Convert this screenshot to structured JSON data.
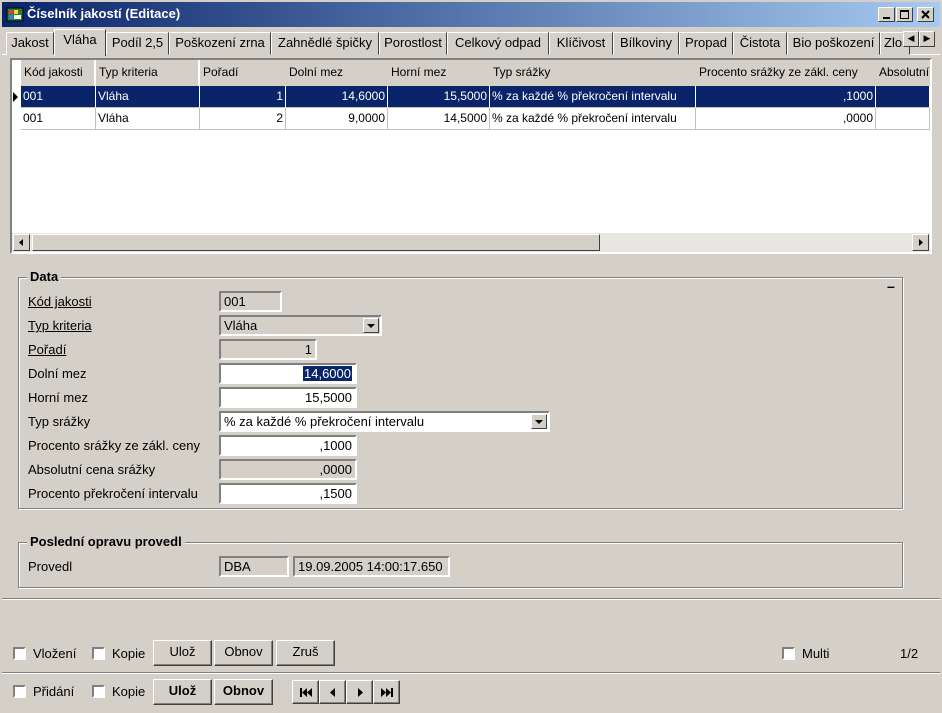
{
  "window": {
    "title": "Číselník jakostí (Editace)",
    "accent": "#0a246a"
  },
  "tabs": [
    {
      "label": "Jakost"
    },
    {
      "label": "Vláha"
    },
    {
      "label": "Podíl 2,5"
    },
    {
      "label": "Poškození zrna"
    },
    {
      "label": "Zahnědlé špičky"
    },
    {
      "label": "Porostlost"
    },
    {
      "label": "Celkový odpad"
    },
    {
      "label": "Klíčivost"
    },
    {
      "label": "Bílkoviny"
    },
    {
      "label": "Propad"
    },
    {
      "label": "Čistota"
    },
    {
      "label": "Bio poškození"
    },
    {
      "label": "Zlomky"
    }
  ],
  "grid": {
    "columns": [
      "Kód jakosti",
      "Typ kriteria",
      "Pořadí",
      "Dolní mez",
      "Horní mez",
      "Typ srážky",
      "Procento srážky ze zákl. ceny",
      "Absolutní"
    ],
    "rows": [
      {
        "kod": "001",
        "typ": "Vláha",
        "poradi": "1",
        "dolni": "14,6000",
        "horni": "15,5000",
        "srazka": "% za každé % překročení intervalu",
        "procento": ",1000",
        "absolutni": ""
      },
      {
        "kod": "001",
        "typ": "Vláha",
        "poradi": "2",
        "dolni": "9,0000",
        "horni": "14,5000",
        "srazka": "% za každé % překročení intervalu",
        "procento": ",0000",
        "absolutni": ""
      }
    ]
  },
  "data_group": {
    "title": "Data",
    "collapse_label": "–",
    "fields": {
      "kod": {
        "label": "Kód jakosti",
        "value": "001"
      },
      "typ": {
        "label": "Typ kriteria",
        "value": "Vláha"
      },
      "poradi": {
        "label": "Pořadí",
        "value": "1"
      },
      "dolni": {
        "label": "Dolní mez",
        "value": "14,6000"
      },
      "horni": {
        "label": "Horní mez",
        "value": "15,5000"
      },
      "srazka": {
        "label": "Typ srážky",
        "value": "% za každé % překročení intervalu"
      },
      "procento": {
        "label": "Procento srážky ze zákl. ceny",
        "value": ",1000"
      },
      "absolutni": {
        "label": "Absolutní cena srážky",
        "value": ",0000"
      },
      "prekroceni": {
        "label": "Procento překročení intervalu",
        "value": ",1500"
      }
    }
  },
  "audit_group": {
    "title": "Poslední opravu provedl",
    "label": "Provedl",
    "user": "DBA",
    "timestamp": "19.09.2005 14:00:17.650"
  },
  "toolbar1": {
    "vlozeni": "Vložení",
    "kopie": "Kopie",
    "uloz": "Ulož",
    "obnov": "Obnov",
    "zrus": "Zruš",
    "multi": "Multi",
    "page": "1/2"
  },
  "toolbar2": {
    "pridani": "Přidání",
    "kopie": "Kopie",
    "uloz": "Ulož",
    "obnov": "Obnov"
  }
}
